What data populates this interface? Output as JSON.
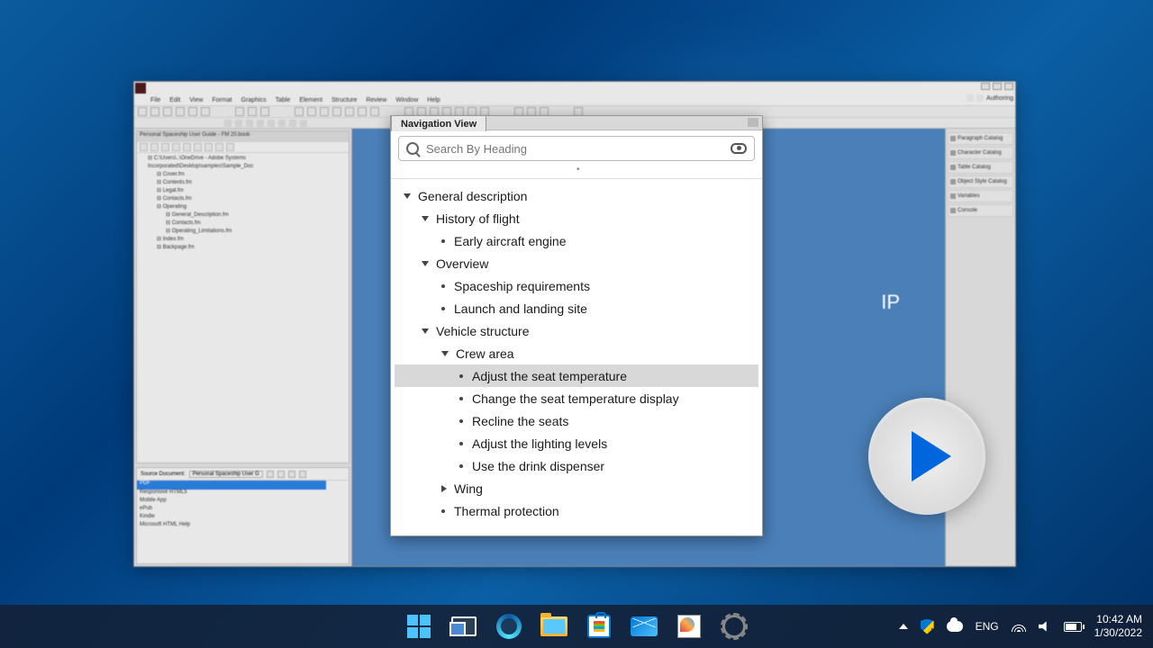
{
  "app": {
    "menubar": [
      "File",
      "Edit",
      "View",
      "Format",
      "Graphics",
      "Table",
      "Element",
      "Structure",
      "Review",
      "Window",
      "Help"
    ],
    "mode_label": "Authoring"
  },
  "left_panel": {
    "tab": "Personal Spaceship User Guide - FM 20.book",
    "tree": [
      {
        "lvl": 1,
        "label": "C:\\Users\\..\\OneDrive - Adobe Systems Incorporated\\Desktop\\samples\\Sample_Doc"
      },
      {
        "lvl": 2,
        "label": "Cover.fm"
      },
      {
        "lvl": 2,
        "label": "Contents.fm"
      },
      {
        "lvl": 2,
        "label": "Legal.fm"
      },
      {
        "lvl": 2,
        "label": "Contacts.fm"
      },
      {
        "lvl": 2,
        "label": "Operating"
      },
      {
        "lvl": 3,
        "label": "General_Description.fm"
      },
      {
        "lvl": 3,
        "label": "Contacts.fm"
      },
      {
        "lvl": 3,
        "label": "Operating_Limitations.fm"
      },
      {
        "lvl": 2,
        "label": "Index.fm"
      },
      {
        "lvl": 2,
        "label": "Backpage.fm"
      }
    ]
  },
  "left_bottom": {
    "label": "Source Document:",
    "dropdown": "Personal Spaceship User G",
    "selected": "PDF",
    "items": [
      "Responsive HTML5",
      "Mobile App",
      "ePub",
      "Kindle",
      "Microsoft HTML Help"
    ]
  },
  "doc": {
    "visible_text": "IP"
  },
  "right_panel": [
    "Paragraph Catalog",
    "Character Catalog",
    "Table Catalog",
    "Object Style Catalog",
    "Variables",
    "Console"
  ],
  "nav": {
    "title": "Navigation View",
    "search_placeholder": "Search By Heading",
    "items": [
      {
        "lvl": 0,
        "caret": "down",
        "label": "General description"
      },
      {
        "lvl": 1,
        "caret": "down",
        "label": "History of flight"
      },
      {
        "lvl": 2,
        "bullet": true,
        "label": "Early aircraft engine"
      },
      {
        "lvl": 1,
        "caret": "down",
        "label": "Overview"
      },
      {
        "lvl": 2,
        "bullet": true,
        "label": "Spaceship requirements"
      },
      {
        "lvl": 2,
        "bullet": true,
        "label": "Launch and landing site"
      },
      {
        "lvl": 1,
        "caret": "down",
        "label": "Vehicle structure"
      },
      {
        "lvl": 2,
        "caret": "down",
        "label": "Crew area"
      },
      {
        "lvl": 3,
        "bullet": true,
        "label": "Adjust the seat temperature",
        "selected": true
      },
      {
        "lvl": 3,
        "bullet": true,
        "label": "Change the seat temperature display"
      },
      {
        "lvl": 3,
        "bullet": true,
        "label": "Recline the seats"
      },
      {
        "lvl": 3,
        "bullet": true,
        "label": "Adjust the lighting levels"
      },
      {
        "lvl": 3,
        "bullet": true,
        "label": "Use the drink dispenser"
      },
      {
        "lvl": 2,
        "caret": "right",
        "label": "Wing"
      },
      {
        "lvl": 2,
        "bullet": true,
        "label": "Thermal protection"
      }
    ]
  },
  "taskbar": {
    "lang": "ENG",
    "time": "10:42 AM",
    "date": "1/30/2022"
  }
}
